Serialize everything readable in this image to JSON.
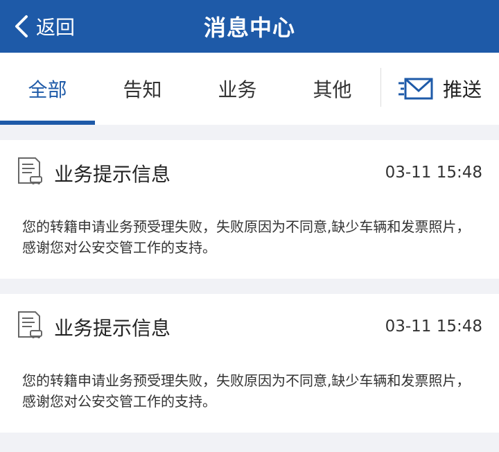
{
  "header": {
    "back_label": "返回",
    "title": "消息中心",
    "color": "#1e5aa8"
  },
  "tabs": [
    {
      "label": "全部",
      "active": true
    },
    {
      "label": "告知",
      "active": false
    },
    {
      "label": "业务",
      "active": false
    },
    {
      "label": "其他",
      "active": false
    }
  ],
  "push": {
    "label": "推送",
    "icon": "mail-icon"
  },
  "messages": [
    {
      "icon": "document-car-icon",
      "title": "业务提示信息",
      "time": "03-11 15:48",
      "body": "您的转籍申请业务预受理失败，失败原因为不同意,缺少车辆和发票照片，感谢您对公安交管工作的支持。"
    },
    {
      "icon": "document-car-icon",
      "title": "业务提示信息",
      "time": "03-11 15:48",
      "body": "您的转籍申请业务预受理失败，失败原因为不同意,缺少车辆和发票照片，感谢您对公安交管工作的支持。"
    }
  ]
}
